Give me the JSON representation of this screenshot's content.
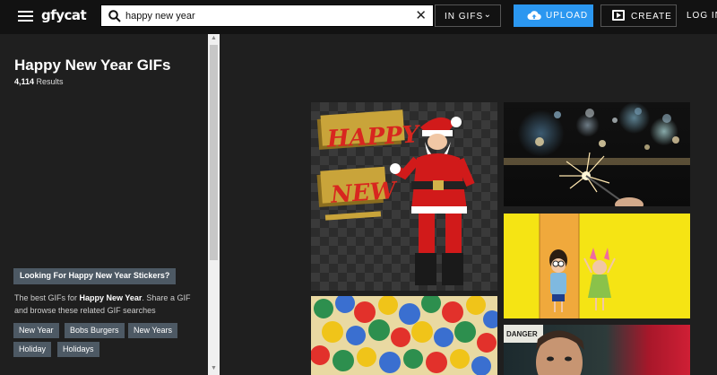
{
  "header": {
    "logo_text": "gfycat",
    "search": {
      "value": "happy new year",
      "placeholder": ""
    },
    "scope_label": "IN GIFS",
    "upload_label": "UPLOAD",
    "create_label": "CREATE",
    "login_label": "LOG IN",
    "colors": {
      "bar": "#121212",
      "upload": "#2b97f0"
    }
  },
  "sidebar": {
    "title": "Happy New Year GIFs",
    "result_count": "4,114",
    "result_suffix": "Results",
    "sticker_button": "Looking For Happy New Year Stickers?",
    "desc_prefix": "The best GIFs for",
    "desc_term": "Happy New Year",
    "desc_suffix": ". Share a GIF and browse these related GIF searches",
    "tags": [
      "New Year",
      "Bobs Burgers",
      "New Years",
      "Holiday",
      "Holidays"
    ]
  },
  "gifs": {
    "happy_new_text": "HAPPY",
    "new_text": "NEW",
    "sign_text": "DANGER"
  }
}
